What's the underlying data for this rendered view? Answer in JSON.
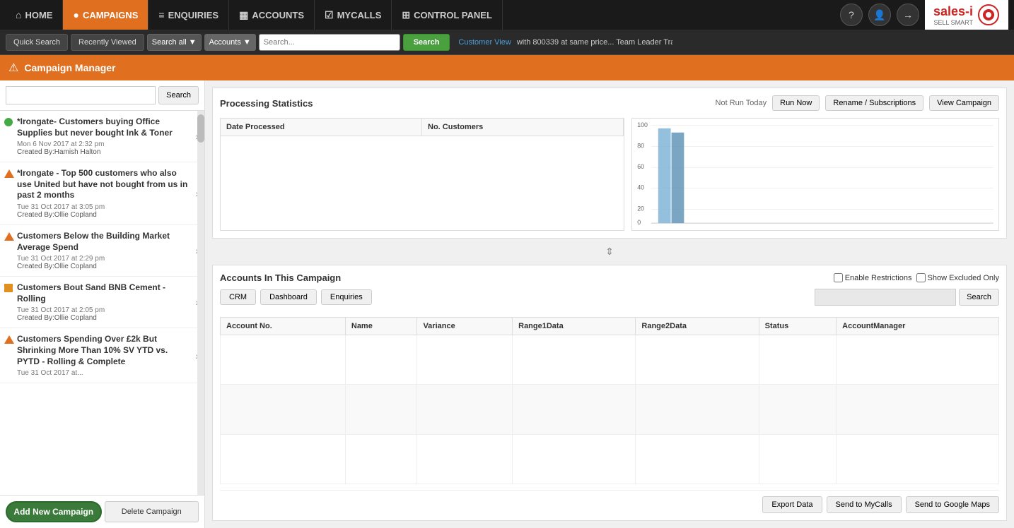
{
  "nav": {
    "items": [
      {
        "id": "home",
        "label": "HOME",
        "icon": "⌂",
        "active": false
      },
      {
        "id": "campaigns",
        "label": "CAMPAIGNS",
        "icon": "●",
        "active": true
      },
      {
        "id": "enquiries",
        "label": "ENQUIRIES",
        "icon": "≡",
        "active": false
      },
      {
        "id": "accounts",
        "label": "ACCOUNTS",
        "icon": "▦",
        "active": false
      },
      {
        "id": "mycalls",
        "label": "MYCALLS",
        "icon": "☑",
        "active": false
      },
      {
        "id": "control_panel",
        "label": "CONTROL PANEL",
        "icon": "⊞",
        "active": false
      }
    ],
    "right_icons": [
      "?",
      "👤",
      "→"
    ]
  },
  "search_bar": {
    "quick_search": "Quick Search",
    "recently_viewed": "Recently Viewed",
    "search_all": "Search all",
    "dropdown_label": "Accounts",
    "placeholder": "Search...",
    "search_btn": "Search",
    "customer_view": "Customer View",
    "ticker_text": "with 800339 at same price... Team Leader Tra"
  },
  "campaign_header": {
    "title": "Campaign Manager"
  },
  "sidebar": {
    "search_placeholder": "",
    "search_btn": "Search",
    "campaigns": [
      {
        "name": "*Irongate- Customers buying Office Supplies but never bought Ink & Toner",
        "date": "Mon 6 Nov 2017 at 2:32 pm",
        "creator": "Created By:Hamish Halton",
        "status": "green"
      },
      {
        "name": "*Irongate - Top 500 customers who also use United but have not bought from us in past 2 months",
        "date": "Tue 31 Oct 2017 at 3:05 pm",
        "creator": "Created By:Ollie Copland",
        "status": "triangle"
      },
      {
        "name": "Customers Below the Building Market Average Spend",
        "date": "Tue 31 Oct 2017 at 2:29 pm",
        "creator": "Created By:Ollie Copland",
        "status": "triangle"
      },
      {
        "name": "Customers Bout Sand BNB Cement - Rolling",
        "date": "Tue 31 Oct 2017 at 2:05 pm",
        "creator": "Created By:Ollie Copland",
        "status": "square"
      },
      {
        "name": "Customers Spending Over £2k But Shrinking More Than 10% SV YTD vs. PYTD - Rolling & Complete",
        "date": "Tue 31 Oct 2017 at...",
        "creator": "",
        "status": "triangle"
      }
    ],
    "add_btn": "Add New Campaign",
    "delete_btn": "Delete Campaign"
  },
  "stats": {
    "title": "Processing Statistics",
    "not_run": "Not Run Today",
    "run_now": "Run Now",
    "rename_subscriptions": "Rename / Subscriptions",
    "view_campaign": "View Campaign",
    "table_headers": [
      "Date Processed",
      "No. Customers"
    ],
    "chart_y_labels": [
      "100",
      "80",
      "60",
      "40",
      "20",
      "0"
    ],
    "chart_bar_height": 85
  },
  "accounts": {
    "title": "Accounts In This Campaign",
    "enable_restrictions": "Enable Restrictions",
    "show_excluded": "Show Excluded Only",
    "crm_btn": "CRM",
    "dashboard_btn": "Dashboard",
    "enquiries_btn": "Enquiries",
    "search_btn": "Search",
    "table_headers": [
      "Account No.",
      "Name",
      "Variance",
      "Range1Data",
      "Range2Data",
      "Status",
      "AccountManager"
    ],
    "rows": [
      {
        "account_no": "",
        "name": "",
        "variance": "",
        "range1": "",
        "range2": "",
        "status": "",
        "manager": ""
      },
      {
        "account_no": "",
        "name": "",
        "variance": "",
        "range1": "",
        "range2": "",
        "status": "",
        "manager": ""
      },
      {
        "account_no": "",
        "name": "",
        "variance": "",
        "range1": "",
        "range2": "",
        "status": "",
        "manager": ""
      }
    ]
  },
  "footer": {
    "export_data": "Export Data",
    "send_mycalls": "Send to MyCalls",
    "send_google_maps": "Send to Google Maps"
  }
}
